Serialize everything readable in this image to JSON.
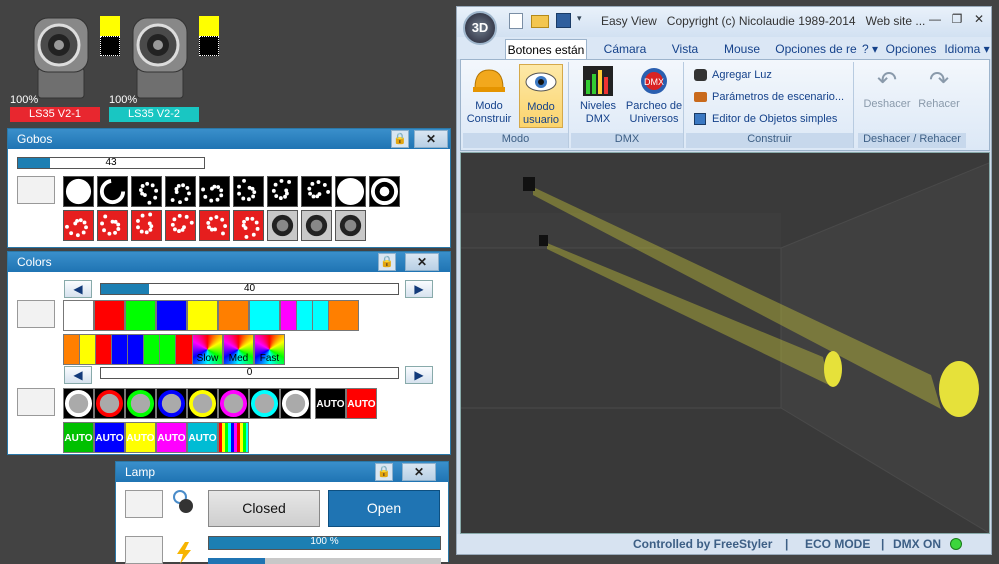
{
  "fixtures": [
    {
      "percent": "100%",
      "label": "LS35 V2-1",
      "color": "#e8272f"
    },
    {
      "percent": "100%",
      "label": "LS35 V2-2",
      "color": "#19c6c2"
    }
  ],
  "gobos": {
    "title": "Gobos",
    "lock": "🔒",
    "close": "✕",
    "slider_value": "43",
    "slider_fraction": 0.17
  },
  "colors": {
    "title": "Colors",
    "lock": "🔒",
    "close": "✕",
    "slider1_value": "40",
    "slider1_fraction": 0.16,
    "slider2_value": "0",
    "slider2_fraction": 0,
    "prev": "◀",
    "next": "▶",
    "row1": [
      "#ffffff",
      "#ff0000",
      "#00ff00",
      "#0000ff",
      "#ffff00",
      "#ff7f00",
      "#00ffff",
      "#ff00ff"
    ],
    "row1_split": [
      "#ff00ff",
      "#00ffff",
      "#00ffff",
      "#ff7f00"
    ],
    "row2": [
      "#ff7f00",
      "#ffff00",
      "#ff0000",
      "#0000ff",
      "#0000ff",
      "#00ff00",
      "#00ff00",
      "#ff0000"
    ],
    "speed": [
      "Slow",
      "Med",
      "Fast"
    ],
    "rings": [
      "#000000",
      "#ff0000",
      "#00ff00",
      "#0000ff",
      "#ffff00",
      "#ff00ff",
      "#00ffff",
      "#ffffff"
    ],
    "auto_label": "AUTO",
    "auto_colors": [
      "#000000",
      "#ff0000",
      "#00c000",
      "#0000ff",
      "#ffff00",
      "#ff00ff",
      "#00bcd4"
    ]
  },
  "lamp": {
    "title": "Lamp",
    "lock": "🔒",
    "close": "✕",
    "closed": "Closed",
    "open": "Open",
    "bar_value": "100 %",
    "bar_fraction": 1.0
  },
  "window": {
    "title": "Easy View   Copyright (c) Nicolaudie 1989-2014   Web site ...",
    "logo": "3D",
    "tabs": [
      "Botones están",
      "Cámara",
      "Vista",
      "Mouse",
      "Opciones de re"
    ],
    "right_tabs": [
      "? ▾",
      "Opciones ▾",
      "Idioma ▾"
    ],
    "groups": {
      "modo": {
        "label": "Modo",
        "buttons": [
          "Modo\nConstruir",
          "Modo\nusuario"
        ]
      },
      "dmx": {
        "label": "DMX",
        "buttons": [
          "Niveles\nDMX",
          "Parcheo de\nUniversos"
        ]
      },
      "construir": {
        "label": "Construir",
        "items": [
          "Agregar Luz",
          "Parámetros de escenario...",
          "Editor de Objetos simples"
        ]
      },
      "undo": {
        "label": "Deshacer / Rehacer",
        "buttons": [
          "Deshacer",
          "Rehacer"
        ]
      }
    },
    "status": [
      "Controlled by FreeStyler",
      "ECO MODE",
      "DMX ON"
    ],
    "win_controls": [
      "—",
      "❐",
      "✕"
    ]
  },
  "colors_theme": {
    "accent": "#1f74b3",
    "beam": "#e6e13a",
    "status_led": "#3cd63c"
  }
}
